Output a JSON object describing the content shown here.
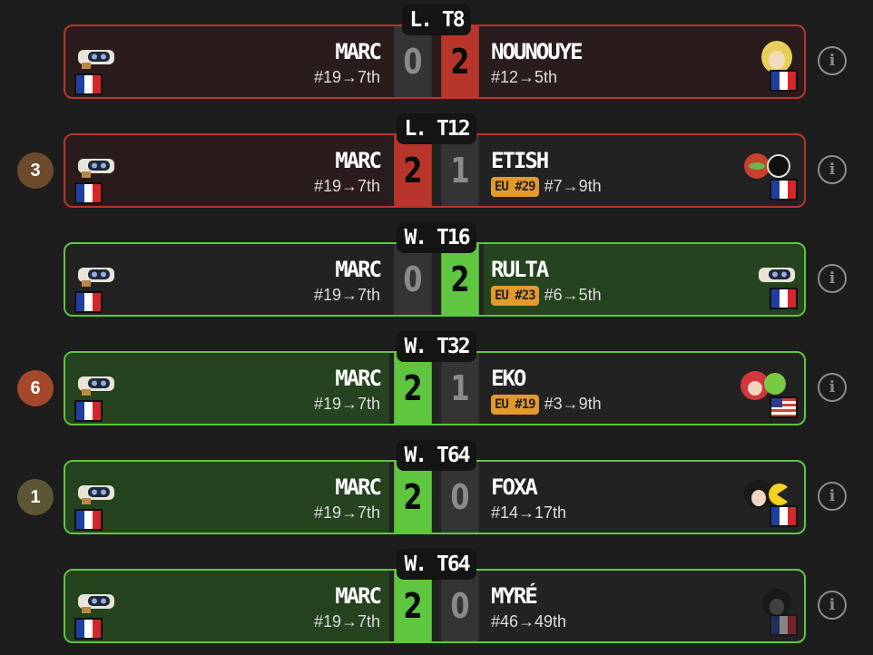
{
  "colors": {
    "win": "#5fc63f",
    "loss": "#b8352b",
    "badge": "#e39a2d"
  },
  "matches": [
    {
      "round": "L. T8",
      "number": "",
      "left": {
        "name": "MARC",
        "seed": "#19→7th",
        "score": "0"
      },
      "right": {
        "name": "NOUNOUYE",
        "seed": "#12→5th",
        "score": "2",
        "badge": ""
      },
      "info_icon": "info-icon"
    },
    {
      "round": "L. T12",
      "number": "3",
      "left": {
        "name": "MARC",
        "seed": "#19→7th",
        "score": "2"
      },
      "right": {
        "name": "ETISH",
        "seed": "#7→9th",
        "score": "1",
        "badge": "EU #29"
      },
      "info_icon": "info-icon"
    },
    {
      "round": "W. T16",
      "number": "",
      "left": {
        "name": "MARC",
        "seed": "#19→7th",
        "score": "0"
      },
      "right": {
        "name": "RULTA",
        "seed": "#6→5th",
        "score": "2",
        "badge": "EU #23"
      },
      "info_icon": "info-icon"
    },
    {
      "round": "W. T32",
      "number": "6",
      "left": {
        "name": "MARC",
        "seed": "#19→7th",
        "score": "2"
      },
      "right": {
        "name": "EKO",
        "seed": "#3→9th",
        "score": "1",
        "badge": "EU #19"
      },
      "info_icon": "info-icon"
    },
    {
      "round": "W. T64",
      "number": "1",
      "left": {
        "name": "MARC",
        "seed": "#19→7th",
        "score": "2"
      },
      "right": {
        "name": "FOXA",
        "seed": "#14→17th",
        "score": "0",
        "badge": ""
      },
      "info_icon": "info-icon"
    },
    {
      "round": "W. T64",
      "number": "",
      "left": {
        "name": "MARC",
        "seed": "#19→7th",
        "score": "2"
      },
      "right": {
        "name": "MYRÉ",
        "seed": "#46→49th",
        "score": "0",
        "badge": ""
      },
      "info_icon": "info-icon"
    }
  ]
}
